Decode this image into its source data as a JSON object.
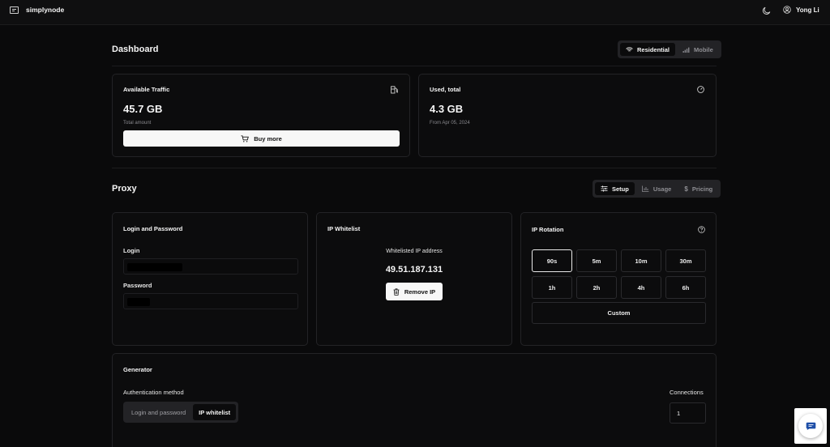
{
  "header": {
    "brand": "simplynode",
    "user": "Yong Li"
  },
  "dashboard": {
    "title": "Dashboard",
    "tabs": [
      {
        "label": "Residential",
        "active": true
      },
      {
        "label": "Mobile",
        "active": false
      }
    ],
    "available": {
      "title": "Available Traffic",
      "value": "45.7 GB",
      "caption": "Total amount",
      "button": "Buy more"
    },
    "used": {
      "title": "Used, total",
      "value": "4.3 GB",
      "caption": "From Apr 05, 2024"
    }
  },
  "proxy": {
    "title": "Proxy",
    "tabs": [
      {
        "label": "Setup",
        "active": true
      },
      {
        "label": "Usage",
        "active": false
      },
      {
        "label": "Pricing",
        "active": false
      }
    ],
    "credentials": {
      "title": "Login and Password",
      "login_label": "Login",
      "password_label": "Password"
    },
    "whitelist": {
      "title": "IP Whitelist",
      "caption": "Whitelisted IP address",
      "ip": "49.51.187.131",
      "remove_button": "Remove IP"
    },
    "rotation": {
      "title": "IP Rotation",
      "options": [
        "90s",
        "5m",
        "10m",
        "30m",
        "1h",
        "2h",
        "4h",
        "6h"
      ],
      "selected": "90s",
      "custom": "Custom"
    },
    "generator": {
      "title": "Generator",
      "auth_label": "Authentication method",
      "auth_options": [
        {
          "label": "Login and password",
          "active": false
        },
        {
          "label": "IP whitelist",
          "active": true
        }
      ],
      "connections_label": "Connections",
      "connections_value": "1"
    }
  },
  "colors": {
    "background": "#0a0a0b",
    "card": "#0c0c0d",
    "border": "#232326",
    "text": "#f5f5f5"
  }
}
